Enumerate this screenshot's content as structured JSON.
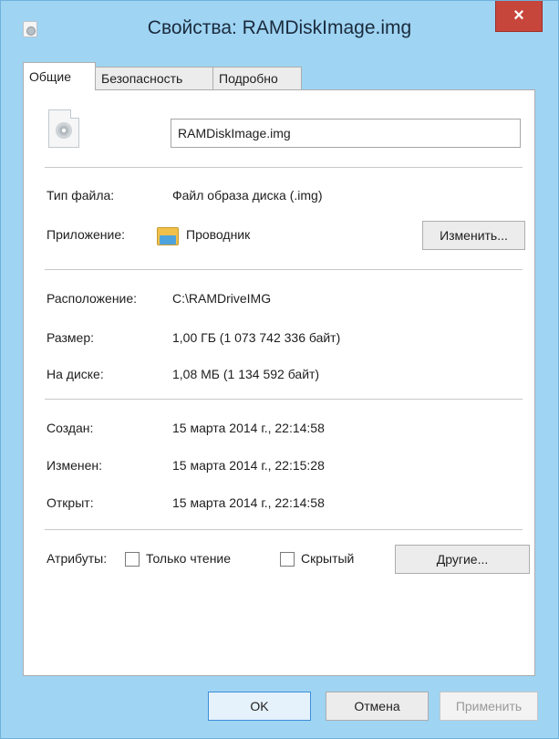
{
  "window": {
    "title": "Свойства: RAMDiskImage.img",
    "close_glyph": "×",
    "icon": "file-properties-icon"
  },
  "tabs": [
    {
      "label": "Общие",
      "active": true
    },
    {
      "label": "Безопасность",
      "active": false
    },
    {
      "label": "Подробно",
      "active": false
    }
  ],
  "general": {
    "file_icon": "disk-image-file-icon",
    "file_name": "RAMDiskImage.img",
    "file_type_label": "Тип файла:",
    "file_type_value": "Файл образа диска (.img)",
    "app_label": "Приложение:",
    "app_icon": "explorer-folder-icon",
    "app_value": "Проводник",
    "change_button": "Изменить...",
    "location_label": "Расположение:",
    "location_value": "C:\\RAMDriveIMG",
    "size_label": "Размер:",
    "size_value": "1,00 ГБ (1 073 742 336 байт)",
    "disk_label": "На диске:",
    "disk_value": "1,08 МБ (1 134 592 байт)",
    "created_label": "Создан:",
    "created_value": "15 марта 2014 г., 22:14:58",
    "modified_label": "Изменен:",
    "modified_value": "15 марта 2014 г., 22:15:28",
    "opened_label": "Открыт:",
    "opened_value": "15 марта 2014 г., 22:14:58",
    "attributes_label": "Атрибуты:",
    "readonly_label": "Только чтение",
    "readonly_checked": false,
    "hidden_label": "Скрытый",
    "hidden_checked": false,
    "other_button": "Другие..."
  },
  "footer": {
    "ok": "OK",
    "cancel": "Отмена",
    "apply": "Применить",
    "apply_enabled": false
  },
  "colors": {
    "frame": "#9fd4f3",
    "close": "#c7463b"
  }
}
